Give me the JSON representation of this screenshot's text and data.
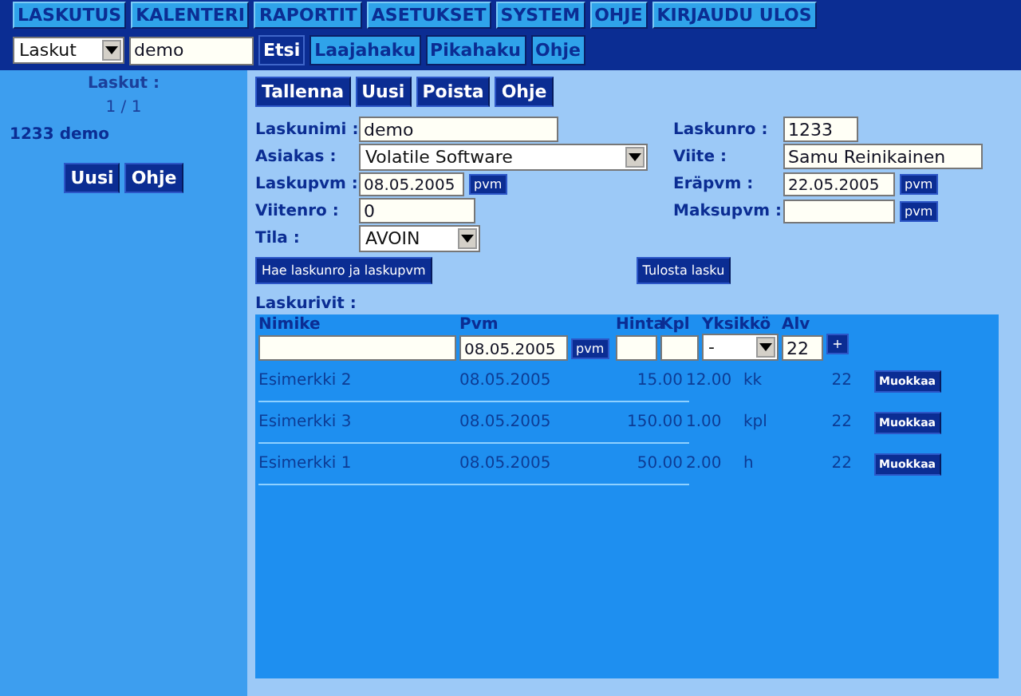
{
  "menu": [
    {
      "label": "LASKUTUS"
    },
    {
      "label": "KALENTERI"
    },
    {
      "label": "RAPORTIT"
    },
    {
      "label": "ASETUKSET"
    },
    {
      "label": "SYSTEM"
    },
    {
      "label": "OHJE"
    },
    {
      "label": "KIRJAUDU ULOS"
    }
  ],
  "search": {
    "category": "Laskut",
    "value": "demo",
    "buttons": [
      {
        "label": "Etsi",
        "kind": "primary"
      },
      {
        "label": "Laajahaku",
        "kind": "secondary"
      },
      {
        "label": "Pikahaku",
        "kind": "secondary"
      },
      {
        "label": "Ohje",
        "kind": "secondary"
      }
    ]
  },
  "sidebar": {
    "title": "Laskut :",
    "pager": "1 / 1",
    "items": [
      {
        "label": "1233 demo"
      }
    ],
    "buttons": [
      "Uusi",
      "Ohje"
    ]
  },
  "toolbar": [
    "Tallenna",
    "Uusi",
    "Poista",
    "Ohje"
  ],
  "form_left": [
    {
      "label": "Laskunimi :",
      "kind": "text",
      "value": "demo"
    },
    {
      "label": "Asiakas :",
      "kind": "select",
      "value": "Volatile Software"
    },
    {
      "label": "Laskupvm :",
      "kind": "date",
      "value": "08.05.2005",
      "button": "pvm"
    },
    {
      "label": "Viitenro :",
      "kind": "short",
      "value": "0"
    },
    {
      "label": "Tila :",
      "kind": "select-short",
      "value": "AVOIN"
    }
  ],
  "form_right": [
    {
      "label": "Laskunro :",
      "kind": "short",
      "value": "1233"
    },
    {
      "label": "Viite :",
      "kind": "text",
      "value": "Samu Reinikainen"
    },
    {
      "label": "Eräpvm :",
      "kind": "date",
      "value": "22.05.2005",
      "button": "pvm"
    },
    {
      "label": "Maksupvm :",
      "kind": "date",
      "button": "pvm"
    }
  ],
  "fetch_button": "Hae laskunro ja laskupvm",
  "print_button": "Tulosta lasku",
  "lines": {
    "title": "Laskurivit :",
    "columns": [
      "Nimike",
      "Pvm",
      "Hinta",
      "Kpl",
      "Yksikkö",
      "Alv"
    ],
    "new_row": {
      "date": "08.05.2005",
      "date_button": "pvm",
      "unit": "-",
      "alv": "22",
      "add_button": "+"
    },
    "rows": [
      {
        "name": "Esimerkki 2",
        "date": "08.05.2005",
        "price": "15.00",
        "qty": "12.00",
        "unit": "kk",
        "alv": "22",
        "button": "Muokkaa"
      },
      {
        "name": "Esimerkki 3",
        "date": "08.05.2005",
        "price": "150.00",
        "qty": "1.00",
        "unit": "kpl",
        "alv": "22",
        "button": "Muokkaa"
      },
      {
        "name": "Esimerkki 1",
        "date": "08.05.2005",
        "price": "50.00",
        "qty": "2.00",
        "unit": "h",
        "alv": "22",
        "button": "Muokkaa"
      }
    ]
  }
}
